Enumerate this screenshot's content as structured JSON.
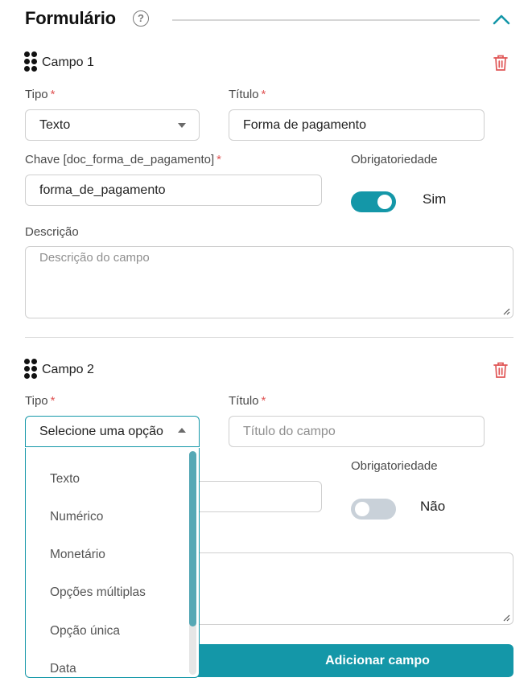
{
  "header": {
    "title": "Formulário",
    "help_symbol": "?"
  },
  "fields": [
    {
      "name": "Campo 1",
      "tipo_label": "Tipo",
      "tipo_value": "Texto",
      "titulo_label": "Título",
      "titulo_value": "Forma de pagamento",
      "chave_label": "Chave [doc_forma_de_pagamento]",
      "chave_value": "forma_de_pagamento",
      "obrigatoriedade_label": "Obrigatoriedade",
      "obrigatoriedade_on": true,
      "obrigatoriedade_text": "Sim",
      "descricao_label": "Descrição",
      "descricao_placeholder": "Descrição do campo"
    },
    {
      "name": "Campo 2",
      "tipo_label": "Tipo",
      "tipo_value": "Selecione uma opção",
      "titulo_label": "Título",
      "titulo_placeholder": "Título do campo",
      "obrigatoriedade_label": "Obrigatoriedade",
      "obrigatoriedade_on": false,
      "obrigatoriedade_text": "Não"
    }
  ],
  "required_mark": "*",
  "dropdown": {
    "options": [
      "Texto",
      "Numérico",
      "Monetário",
      "Opções múltiplas",
      "Opção única",
      "Data"
    ]
  },
  "add_button_label": "Adicionar campo",
  "icons": {
    "help": "help-circle-icon",
    "collapse": "chevron-up-icon",
    "drag": "drag-handle-icon",
    "delete": "trash-icon",
    "select": "caret-down-icon"
  },
  "colors": {
    "accent": "#1497a8",
    "required": "#e05656",
    "delete": "#e05656",
    "toggle_off": "#c9d1d9"
  }
}
